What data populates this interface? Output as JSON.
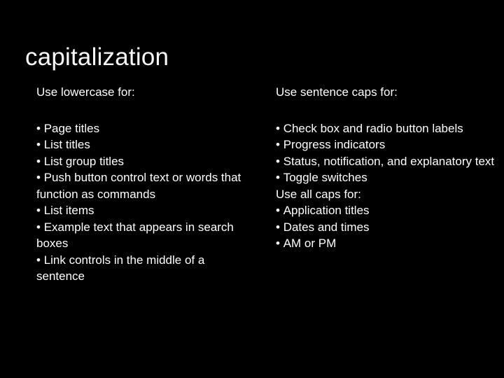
{
  "slide": {
    "title": "capitalization",
    "background_color": "#000000",
    "text_color": "#ffffff",
    "left_column": {
      "heading": "Use lowercase for:",
      "items": [
        {
          "text": "Page titles",
          "bulleted": true
        },
        {
          "text": "List titles",
          "bulleted": true
        },
        {
          "text": "List group titles",
          "bulleted": true
        },
        {
          "text": "Push button control text or words that function as commands",
          "bulleted": true
        },
        {
          "text": "List items",
          "bulleted": true
        },
        {
          "text": "Example text that appears in search boxes",
          "bulleted": true
        },
        {
          "text": "Link controls in the middle of a sentence",
          "bulleted": true
        }
      ]
    },
    "right_column": {
      "heading": "Use sentence caps for:",
      "items": [
        {
          "text": "Check box and radio button labels",
          "bulleted": true
        },
        {
          "text": "Progress indicators",
          "bulleted": true
        },
        {
          "text": "Status, notification, and explanatory text",
          "bulleted": true
        },
        {
          "text": "Toggle switches",
          "bulleted": true
        }
      ],
      "secondary_heading": "Use all caps for:",
      "secondary_items": [
        {
          "text": "Application titles",
          "bulleted": true
        },
        {
          "text": "Dates and times",
          "bulleted": true
        },
        {
          "text": "AM or PM",
          "bulleted": true
        }
      ]
    }
  }
}
